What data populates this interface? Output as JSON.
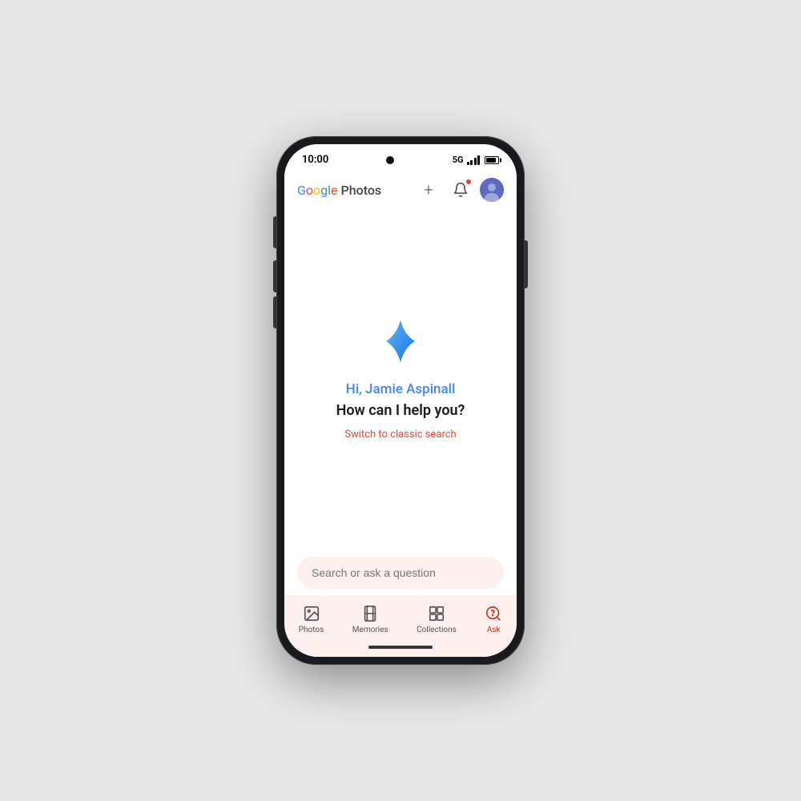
{
  "status_bar": {
    "time": "10:00",
    "network": "5G"
  },
  "header": {
    "logo_google": "Google",
    "logo_google_letters": [
      "G",
      "o",
      "o",
      "g",
      "l",
      "e"
    ],
    "logo_photos": " Photos",
    "add_button_label": "+",
    "notification_label": "notifications"
  },
  "main": {
    "greeting": "Hi, Jamie Aspinall",
    "help_text": "How can I help you?",
    "switch_search_label": "Switch to classic search"
  },
  "search": {
    "placeholder": "Search or ask a question"
  },
  "bottom_nav": {
    "items": [
      {
        "id": "photos",
        "label": "Photos",
        "active": false
      },
      {
        "id": "memories",
        "label": "Memories",
        "active": false
      },
      {
        "id": "collections",
        "label": "Collections",
        "active": false
      },
      {
        "id": "ask",
        "label": "Ask",
        "active": true
      }
    ]
  }
}
